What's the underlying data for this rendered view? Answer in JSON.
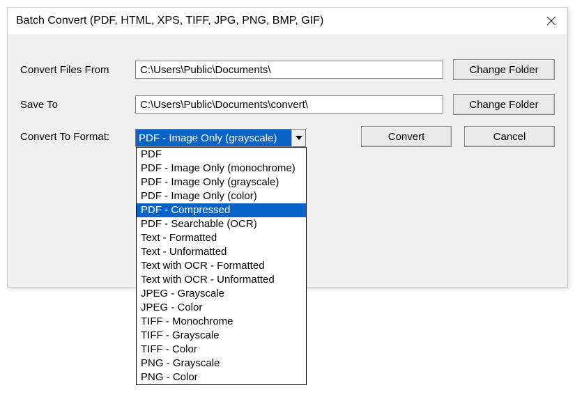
{
  "window": {
    "title": "Batch Convert (PDF, HTML, XPS, TIFF, JPG, PNG, BMP, GIF)"
  },
  "labels": {
    "convert_from": "Convert Files From",
    "save_to": "Save To",
    "convert_to_format": "Convert To Format:"
  },
  "fields": {
    "convert_from_path": "C:\\Users\\Public\\Documents\\",
    "save_to_path": "C:\\Users\\Public\\Documents\\convert\\",
    "format_selected": "PDF - Image Only (grayscale)"
  },
  "buttons": {
    "change_folder": "Change Folder",
    "convert": "Convert",
    "cancel": "Cancel"
  },
  "format_options": [
    "PDF",
    "PDF - Image Only (monochrome)",
    "PDF - Image Only (grayscale)",
    "PDF - Image Only (color)",
    "PDF - Compressed",
    "PDF - Searchable (OCR)",
    "Text - Formatted",
    "Text - Unformatted",
    "Text with OCR - Formatted",
    "Text with OCR - Unformatted",
    "JPEG - Grayscale",
    "JPEG - Color",
    "TIFF - Monochrome",
    "TIFF - Grayscale",
    "TIFF - Color",
    "PNG - Grayscale",
    "PNG - Color"
  ],
  "format_highlight_index": 4
}
